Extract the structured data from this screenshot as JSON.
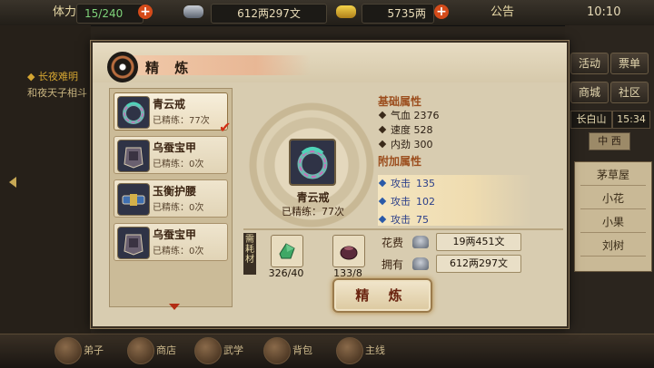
{
  "topbar": {
    "stamina_label": "体力",
    "stamina_value": "15/240",
    "silver_value": "612两297文",
    "gold_value": "5735两",
    "notice_label": "公告",
    "clock": "10:10"
  },
  "background": {
    "news_line1": "◆ 长夜难明",
    "news_line2": "和夜天子相斗"
  },
  "right_panel": {
    "buttons": [
      "活动",
      "票单",
      "商城",
      "社区"
    ],
    "location": "长白山",
    "location_time": "15:34",
    "tab_label": "中 西",
    "list": [
      "茅草屋",
      "小花",
      "小果",
      "刘树"
    ]
  },
  "bottom_bar": {
    "labels": [
      "弟子",
      "商店",
      "武学",
      "背包",
      "主线"
    ]
  },
  "modal": {
    "title": "精 炼",
    "items": [
      {
        "name": "青云戒",
        "count": "已精练：77次",
        "selected": true
      },
      {
        "name": "乌蚕宝甲",
        "count": "已精练：0次",
        "selected": false
      },
      {
        "name": "玉衡护腰",
        "count": "已精练：0次",
        "selected": false
      },
      {
        "name": "乌蚕宝甲",
        "count": "已精练：0次",
        "selected": false
      }
    ],
    "selected_item": {
      "name": "青云戒",
      "count": "已精练：77次"
    },
    "base_attrs": {
      "title": "基础属性",
      "rows": [
        {
          "label": "气血",
          "value": "2376"
        },
        {
          "label": "速度",
          "value": "528"
        },
        {
          "label": "内劲",
          "value": "300"
        }
      ]
    },
    "extra_attrs": {
      "title": "附加属性",
      "rows": [
        {
          "label": "攻击",
          "value": "135"
        },
        {
          "label": "攻击",
          "value": "102"
        },
        {
          "label": "攻击",
          "value": "75"
        }
      ]
    },
    "materials": {
      "label": "需耗材",
      "items": [
        {
          "icon": "jade-material-icon",
          "count": "326/40"
        },
        {
          "icon": "pouch-material-icon",
          "count": "133/8"
        }
      ]
    },
    "cost": {
      "cost_label": "花费",
      "cost_value": "19两451文",
      "own_label": "拥有",
      "own_value": "612两297文"
    },
    "refine_button": "精 炼"
  },
  "colors": {
    "title_banner": "#e8b795",
    "extra_attr_text": "#2b3f8a",
    "check_mark": "#d12f15",
    "refine_text": "#6a2410"
  }
}
